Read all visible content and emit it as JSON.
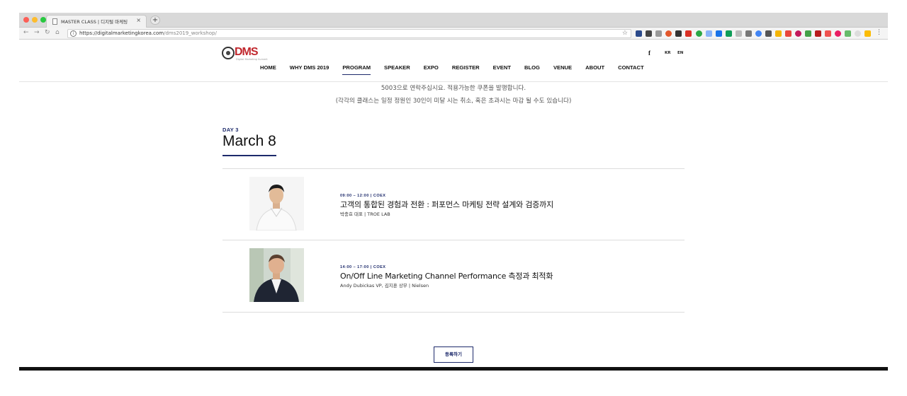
{
  "browser": {
    "tab_title": "MASTER CLASS | 디지털 마케팅",
    "tab_close": "×",
    "new_tab": "+",
    "info_icon_char": "i",
    "url_host": "https://digitalmarketingkorea.com",
    "url_path": "/dms2019_workshop/",
    "star": "☆",
    "menu": "⋮",
    "nav": {
      "back": "←",
      "forward": "→",
      "reload": "↻",
      "home": "⌂"
    }
  },
  "site": {
    "logo_text": "DMS",
    "logo_tagline": "Digital Marketing Summit",
    "lang_kr": "KR",
    "lang_en": "EN",
    "facebook": "f",
    "nav_items": [
      "HOME",
      "WHY DMS 2019",
      "PROGRAM",
      "SPEAKER",
      "EXPO",
      "REGISTER",
      "EVENT",
      "BLOG",
      "VENUE",
      "ABOUT",
      "CONTACT"
    ],
    "active_nav": "PROGRAM"
  },
  "notes": {
    "line1": "5003으로 연락주십시요.  적용가능한 쿠폰을 발행합니다.",
    "line2": "(각각의 클래스는 일정 정원인 30인이 미달 시는 취소, 혹은 초과시는 마감 될 수도 있습니다)"
  },
  "day": {
    "label": "DAY 3",
    "title": "March 8"
  },
  "sessions": [
    {
      "meta": "09:00 – 12:00  |  COEX",
      "title": "고객의 통합된 경험과 전환 : 퍼포먼스 마케팅 전략 설계와 검증까지",
      "speaker": "박충효 대표  |  TROE LAB"
    },
    {
      "meta": "14:00 – 17:00  |  COEX",
      "title": "On/Off Line Marketing Channel Performance 측정과 최적화",
      "speaker": "Andy Dubickas VP, 김지훈 상무  |  Nielsen"
    }
  ],
  "register_button": "등록하기",
  "colors": {
    "accent": "#1d2a6b",
    "logo_red": "#c1272d"
  }
}
